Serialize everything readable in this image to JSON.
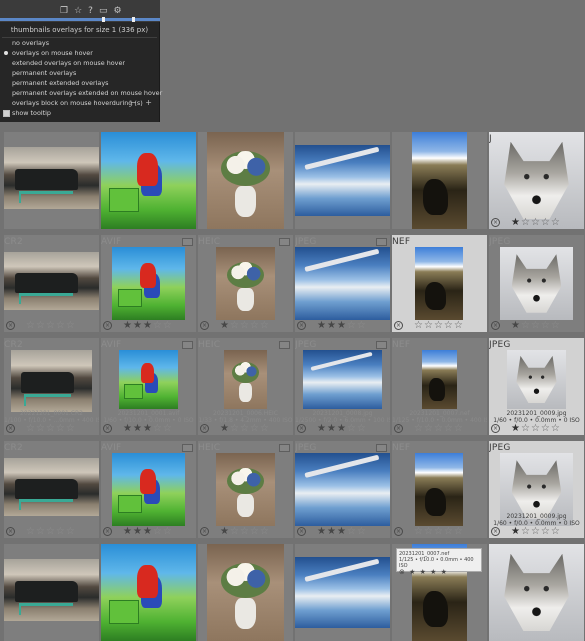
{
  "toolbar": {
    "icons": [
      "group-icon",
      "star-icon",
      "help-icon",
      "keyboard-icon",
      "gear-icon"
    ]
  },
  "menu": {
    "title": "thumbnails overlays for size 1 (336 px)",
    "items": [
      {
        "label": "no overlays",
        "selected": false
      },
      {
        "label": "overlays on mouse hover",
        "selected": true
      },
      {
        "label": "extended overlays on mouse hover",
        "selected": false
      },
      {
        "label": "permanent overlays",
        "selected": false
      },
      {
        "label": "permanent extended overlays",
        "selected": false
      },
      {
        "label": "permanent overlays extended on mouse hover",
        "selected": false
      },
      {
        "label": "overlays block on mouse hoverduring (s)",
        "selected": false
      }
    ],
    "block_seconds": "1",
    "show_tooltip_label": "show tooltip",
    "show_tooltip_checked": true
  },
  "rows": [
    {
      "mode": "plain",
      "cells": [
        {
          "ext": "",
          "art": "car",
          "info": "",
          "stars": 0
        },
        {
          "ext": "",
          "art": "mario",
          "info": "",
          "stars": 0
        },
        {
          "ext": "",
          "art": "flower",
          "info": "",
          "stars": 0
        },
        {
          "ext": "",
          "art": "plane",
          "info": "",
          "stars": 0
        },
        {
          "ext": "",
          "art": "nef",
          "info": "",
          "stars": 0
        },
        {
          "ext": "J",
          "art": "wolf",
          "info": "",
          "stars": 1,
          "hover": true
        }
      ]
    },
    {
      "mode": "overlay",
      "cells": [
        {
          "ext": "CR2",
          "art": "car",
          "info": "",
          "stars": 0
        },
        {
          "ext": "AVIF",
          "art": "mario",
          "info": "",
          "stars": 3
        },
        {
          "ext": "HEIC",
          "art": "flower",
          "info": "",
          "stars": 1
        },
        {
          "ext": "JPEG",
          "art": "plane",
          "info": "",
          "stars": 3
        },
        {
          "ext": "NEF",
          "art": "nef",
          "info": "",
          "stars": 0,
          "hover": true
        },
        {
          "ext": "JPEG",
          "art": "wolf",
          "info": "",
          "stars": 1
        }
      ]
    },
    {
      "mode": "extended",
      "cells": [
        {
          "ext": "CR2",
          "art": "car",
          "name": "20221201_0001.CR2",
          "info": "1/100 • f/10.0 • ...0mm • 400 ISO",
          "stars": 0
        },
        {
          "ext": "AVIF",
          "art": "mario",
          "name": "20231201_0001.avif",
          "info": "1/60 • f/10.0 • 0.0mm • 0 ISO",
          "stars": 3
        },
        {
          "ext": "HEIC",
          "art": "flower",
          "name": "20231201_0006.HEIC",
          "info": "1/33 • f/1.8 • 4.2mm • 400 ISO",
          "stars": 1
        },
        {
          "ext": "JPEG",
          "art": "plane",
          "name": "20231201_0008.jpg",
          "info": "1/2500 • f/2.0 • 6.0mm • 100 ISO",
          "stars": 3
        },
        {
          "ext": "NEF",
          "art": "nef",
          "name": "20231201_0007.nef",
          "info": "1/125 • f/10.0 • 0.0mm • 400 ISO",
          "stars": 0
        },
        {
          "ext": "JPEG",
          "art": "wolf",
          "name": "20231201_0009.jpg",
          "info": "1/60 • f/0.0 • 0.0mm • 0 ISO",
          "stars": 1,
          "hover": true
        }
      ]
    },
    {
      "mode": "overlay",
      "cells": [
        {
          "ext": "CR2",
          "art": "car",
          "info": "",
          "stars": 0
        },
        {
          "ext": "AVIF",
          "art": "mario",
          "info": "",
          "stars": 3
        },
        {
          "ext": "HEIC",
          "art": "flower",
          "info": "",
          "stars": 1
        },
        {
          "ext": "JPEG",
          "art": "plane",
          "info": "",
          "stars": 3
        },
        {
          "ext": "NEF",
          "art": "nef",
          "info": "",
          "stars": 0
        },
        {
          "ext": "JPEG",
          "art": "wolf",
          "name": "20231201_0009.jpg",
          "info": "1/60 • f/0.0 • 0.0mm • 0 ISO",
          "stars": 1,
          "hover": true
        }
      ]
    },
    {
      "mode": "plain",
      "cells": [
        {
          "ext": "",
          "art": "car",
          "info": "",
          "stars": 0
        },
        {
          "ext": "",
          "art": "mario",
          "info": "",
          "stars": 0
        },
        {
          "ext": "",
          "art": "flower",
          "info": "",
          "stars": 0
        },
        {
          "ext": "",
          "art": "plane",
          "info": "",
          "stars": 0
        },
        {
          "ext": "",
          "art": "nef",
          "info": "",
          "stars": 0,
          "tooltip": {
            "name": "20231201_0007.nef",
            "info": "1/125 • f/10.0 • 0.0mm • 400 ISO"
          }
        },
        {
          "ext": "",
          "art": "wolf",
          "info": "",
          "stars": 0
        }
      ]
    }
  ]
}
